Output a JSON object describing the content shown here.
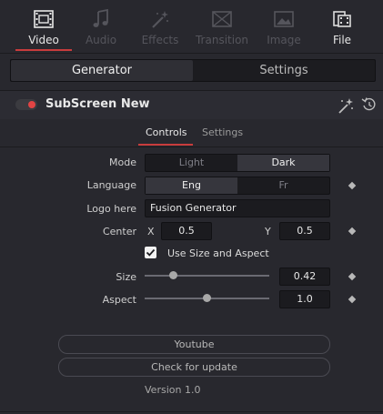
{
  "top_tabs": [
    {
      "label": "Video",
      "icon": "film-icon",
      "state": "active"
    },
    {
      "label": "Audio",
      "icon": "music-note-icon",
      "state": "disabled"
    },
    {
      "label": "Effects",
      "icon": "magic-wand-icon",
      "state": "disabled"
    },
    {
      "label": "Transition",
      "icon": "transition-icon",
      "state": "disabled"
    },
    {
      "label": "Image",
      "icon": "image-icon",
      "state": "disabled"
    },
    {
      "label": "File",
      "icon": "file-film-icon",
      "state": "enabled"
    }
  ],
  "main_segment": {
    "generator": "Generator",
    "settings": "Settings",
    "active": "Generator"
  },
  "node": {
    "title": "SubScreen New",
    "enabled": true
  },
  "sub_tabs": {
    "controls": "Controls",
    "settings": "Settings",
    "active": "Controls"
  },
  "controls": {
    "mode": {
      "label": "Mode",
      "options": [
        "Light",
        "Dark"
      ],
      "selected": "Dark"
    },
    "language": {
      "label": "Language",
      "options": [
        "Eng",
        "Fr"
      ],
      "selected": "Eng"
    },
    "logo": {
      "label": "Logo here",
      "value": "Fusion Generator"
    },
    "center": {
      "label": "Center",
      "x_label": "X",
      "x_value": "0.5",
      "y_label": "Y",
      "y_value": "0.5"
    },
    "use_size_aspect": {
      "label": "Use Size and Aspect",
      "checked": true
    },
    "size": {
      "label": "Size",
      "value": "0.42",
      "slider_fraction": 0.23
    },
    "aspect": {
      "label": "Aspect",
      "value": "1.0",
      "slider_fraction": 0.5
    }
  },
  "buttons": {
    "youtube": "Youtube",
    "check_update": "Check for update"
  },
  "version": "Version 1.0",
  "colors": {
    "accent": "#c83c3c",
    "toggle_on": "#e24444",
    "background": "#28282e"
  }
}
